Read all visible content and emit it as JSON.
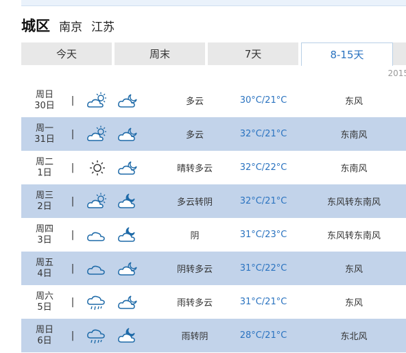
{
  "header": {
    "district": "城区",
    "city": "南京",
    "province": "江苏"
  },
  "tabs": [
    {
      "label": "今天",
      "active": false
    },
    {
      "label": "周末",
      "active": false
    },
    {
      "label": "7天",
      "active": false
    },
    {
      "label": "8-15天",
      "active": true
    }
  ],
  "year_hint": "2015",
  "colors": {
    "accent": "#2a73c0",
    "row_alt": "#c2d3ea",
    "tab_bg": "#e8e8e8"
  },
  "days": [
    {
      "weekday": "周日",
      "day": "30日",
      "icon_day": "partly-cloudy-icon",
      "icon_night": "cloudy-moon-icon",
      "desc": "多云",
      "temp": "30°C/21°C",
      "wind": "东风"
    },
    {
      "weekday": "周一",
      "day": "31日",
      "icon_day": "partly-cloudy-icon",
      "icon_night": "cloudy-moon-icon",
      "desc": "多云",
      "temp": "32°C/21°C",
      "wind": "东南风"
    },
    {
      "weekday": "周二",
      "day": "1日",
      "icon_day": "sun-icon",
      "icon_night": "cloudy-moon-icon",
      "desc": "晴转多云",
      "temp": "32°C/22°C",
      "wind": "东南风"
    },
    {
      "weekday": "周三",
      "day": "2日",
      "icon_day": "partly-cloudy-icon",
      "icon_night": "overcast-moon-icon",
      "desc": "多云转阴",
      "temp": "32°C/21°C",
      "wind": "东风转东南风"
    },
    {
      "weekday": "周四",
      "day": "3日",
      "icon_day": "cloud-icon",
      "icon_night": "overcast-moon-icon",
      "desc": "阴",
      "temp": "31°C/23°C",
      "wind": "东风转东南风"
    },
    {
      "weekday": "周五",
      "day": "4日",
      "icon_day": "cloud-icon",
      "icon_night": "cloudy-moon-icon",
      "desc": "阴转多云",
      "temp": "31°C/22°C",
      "wind": "东风"
    },
    {
      "weekday": "周六",
      "day": "5日",
      "icon_day": "rain-icon",
      "icon_night": "cloudy-moon-icon",
      "desc": "雨转多云",
      "temp": "31°C/21°C",
      "wind": "东风"
    },
    {
      "weekday": "周日",
      "day": "6日",
      "icon_day": "rain-icon",
      "icon_night": "overcast-moon-icon",
      "desc": "雨转阴",
      "temp": "28°C/21°C",
      "wind": "东北风"
    }
  ]
}
